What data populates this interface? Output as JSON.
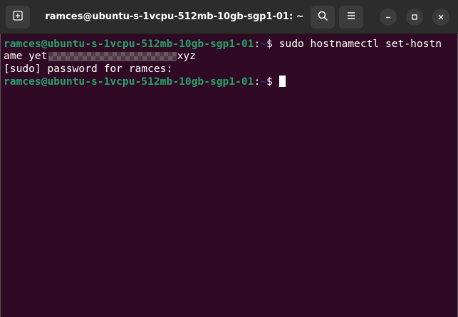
{
  "window": {
    "title": "ramces@ubuntu-s-1vcpu-512mb-10gb-sgp1-01: ~"
  },
  "titlebar": {
    "icons": {
      "new_tab": "new-tab-icon",
      "search": "search-icon",
      "menu": "hamburger-menu-icon",
      "minimize": "minimize-icon",
      "maximize": "maximize-icon",
      "close": "close-icon"
    }
  },
  "colors": {
    "terminal_bg": "#300a24",
    "titlebar_bg": "#2c2c2c",
    "prompt_user": "#26a269",
    "prompt_path": "#12488b",
    "text": "#ffffff"
  },
  "terminal": {
    "lines": [
      {
        "prompt_user": "ramces@ubuntu-s-1vcpu-512mb-10gb-sgp1-01",
        "prompt_sep": ":",
        "prompt_path": "~",
        "prompt_symbol": "$ ",
        "command": "sudo hostnamectl set-hostn"
      },
      {
        "text_before": "ame yet",
        "text_after": "xyz"
      },
      {
        "text": "[sudo] password for ramces:"
      },
      {
        "prompt_user": "ramces@ubuntu-s-1vcpu-512mb-10gb-sgp1-01",
        "prompt_sep": ":",
        "prompt_path": "~",
        "prompt_symbol": "$ "
      }
    ]
  }
}
